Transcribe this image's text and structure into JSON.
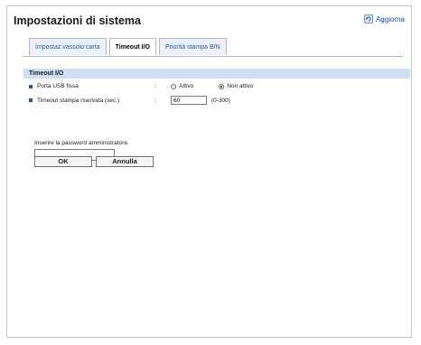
{
  "page": {
    "title": "Impostazioni di sistema",
    "refresh_label": "Aggiorna"
  },
  "tabs": [
    {
      "label": "Impostaz.vassoio carta",
      "active": false
    },
    {
      "label": "Timeout I/O",
      "active": true
    },
    {
      "label": "Priorità stampa B/N",
      "active": false
    }
  ],
  "section": {
    "title": "Timeout I/O",
    "usb_port": {
      "label": "Porta USB fissa",
      "separator": ":",
      "options": [
        "Attivo",
        "Non attivo"
      ],
      "selected": "Non attivo"
    },
    "reserved_timeout": {
      "label": "Timeout stampa riservata (sec.)",
      "separator": ":",
      "value": "60",
      "range": "(0-300)"
    }
  },
  "admin": {
    "prompt": "Inserire la password amministratore.",
    "password_value": ""
  },
  "buttons": {
    "ok": "OK",
    "cancel": "Annulla"
  },
  "colors": {
    "section_header": "#cfe0f5",
    "bullet": "#2a52a8",
    "tab_link": "#2a5ba8"
  },
  "icons": {
    "refresh": "refresh-icon"
  }
}
